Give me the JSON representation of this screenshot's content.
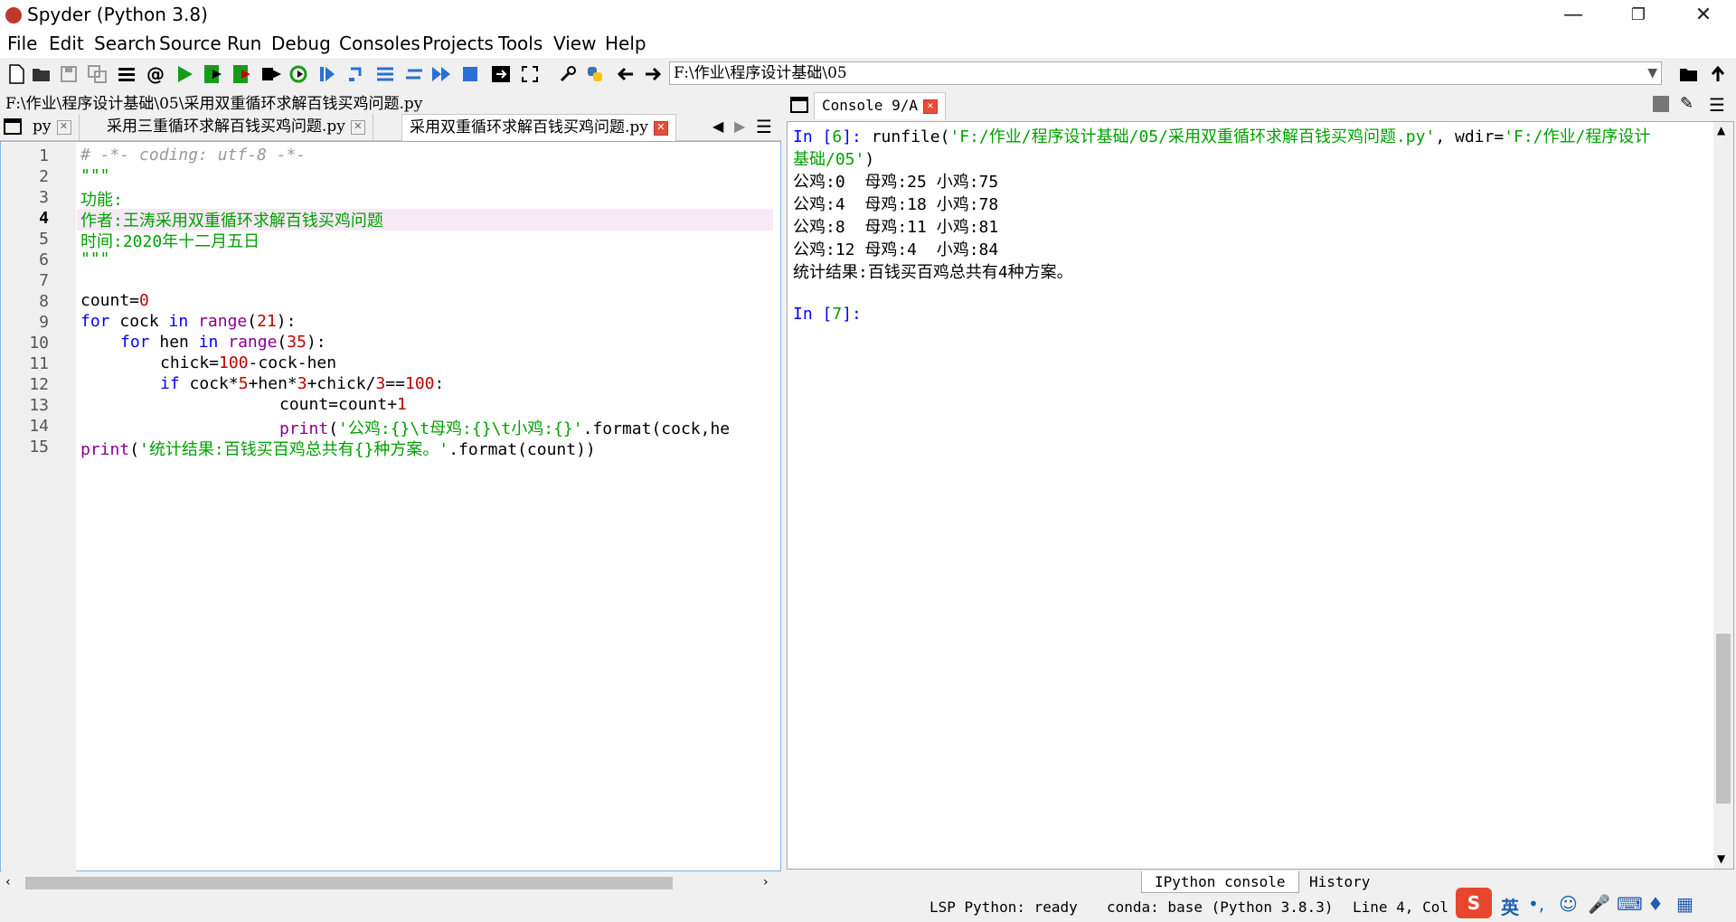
{
  "window": {
    "title": "Spyder (Python 3.8)",
    "minimize": "—",
    "restore": "❐",
    "close": "✕"
  },
  "menu": [
    "File",
    "Edit",
    "Search",
    "Source",
    "Run",
    "Debug",
    "Consoles",
    "Projects",
    "Tools",
    "View",
    "Help"
  ],
  "toolbar": {
    "icons": [
      "new-file-icon",
      "open-folder-icon",
      "save-icon",
      "save-all-icon",
      "list-icon",
      "at-icon",
      "run-icon",
      "run-cell-icon",
      "run-cell-advance-icon",
      "run-selection-icon",
      "rerun-icon",
      "debug-icon",
      "step-icon",
      "step-into-icon",
      "step-return-icon",
      "continue-icon",
      "stop-icon",
      "maximize-pane-icon",
      "fullscreen-icon",
      "wrench-icon",
      "python-path-icon",
      "back-arrow-icon",
      "forward-arrow-icon"
    ],
    "working_dir": "F:\\作业\\程序设计基础\\05"
  },
  "editor": {
    "file_path": "F:\\作业\\程序设计基础\\05\\采用双重循环求解百钱买鸡问题.py",
    "tabs": [
      {
        "label": "py"
      },
      {
        "label": "采用三重循环求解百钱买鸡问题.py"
      },
      {
        "label": "采用双重循环求解百钱买鸡问题.py"
      }
    ],
    "current_line": 4,
    "line_numbers": [
      "1",
      "2",
      "3",
      "4",
      "5",
      "6",
      "7",
      "8",
      "9",
      "10",
      "11",
      "12",
      "13",
      "14",
      "15"
    ],
    "code": {
      "l1": "# -*- coding: utf-8 -*-",
      "l2": "\"\"\"",
      "l3": "功能:",
      "l4": "作者:王涛采用双重循环求解百钱买鸡问题",
      "l5": "时间:2020年十二月五日",
      "l6": "\"\"\"",
      "l8_a": "count=",
      "l8_b": "0",
      "l9_kw": "for",
      "l9_a": " cock ",
      "l9_in": "in",
      "l9_sp": " ",
      "l9_fn": "range",
      "l9_b": "(",
      "l9_n": "21",
      "l9_c": "):",
      "l10_kw": "for",
      "l10_a": " hen ",
      "l10_in": "in",
      "l10_sp": " ",
      "l10_fn": "range",
      "l10_b": "(",
      "l10_n": "35",
      "l10_c": "):",
      "l11_a": "chick=",
      "l11_n": "100",
      "l11_b": "-cock-hen",
      "l12_kw": "if",
      "l12_a": " cock*",
      "l12_n1": "5",
      "l12_b": "+hen*",
      "l12_n2": "3",
      "l12_c": "+chick/",
      "l12_n3": "3",
      "l12_d": "==",
      "l12_n4": "100",
      "l12_e": ":",
      "l13_a": "count=count+",
      "l13_n": "1",
      "l14_fn": "print",
      "l14_a": "(",
      "l14_s": "'公鸡:{}\\t母鸡:{}\\t小鸡:{}'",
      "l14_b": ".format(cock,he",
      "l15_fn": "print",
      "l15_a": "(",
      "l15_s": "'统计结果:百钱买百鸡总共有{}种方案。'",
      "l15_b": ".format(count))"
    }
  },
  "console": {
    "tab_label": "Console 9/A",
    "lines": {
      "in6_prompt": "In [",
      "in6_num": "6",
      "in6_close": "]: ",
      "in6_cmd": "runfile(",
      "in6_arg1": "'F:/作业/程序设计基础/05/采用双重循环求解百钱买鸡问题.py'",
      "in6_mid": ", wdir=",
      "in6_arg2": "'F:/作业/程序设计",
      "in6_arg2b": "基础/05'",
      "in6_end": ")",
      "out1": "公鸡:0  母鸡:25 小鸡:75",
      "out2": "公鸡:4  母鸡:18 小鸡:78",
      "out3": "公鸡:8  母鸡:11 小鸡:81",
      "out4": "公鸡:12 母鸡:4  小鸡:84",
      "out5": "统计结果:百钱买百鸡总共有4种方案。",
      "in7_prompt": "In [",
      "in7_num": "7",
      "in7_close": "]:"
    },
    "bottom_tabs": [
      "IPython console",
      "History"
    ]
  },
  "status": {
    "lsp": "LSP Python: ready",
    "conda": "conda: base (Python 3.8.3)",
    "position": "Line 4, Col 2"
  },
  "ime": {
    "lang": "英"
  }
}
